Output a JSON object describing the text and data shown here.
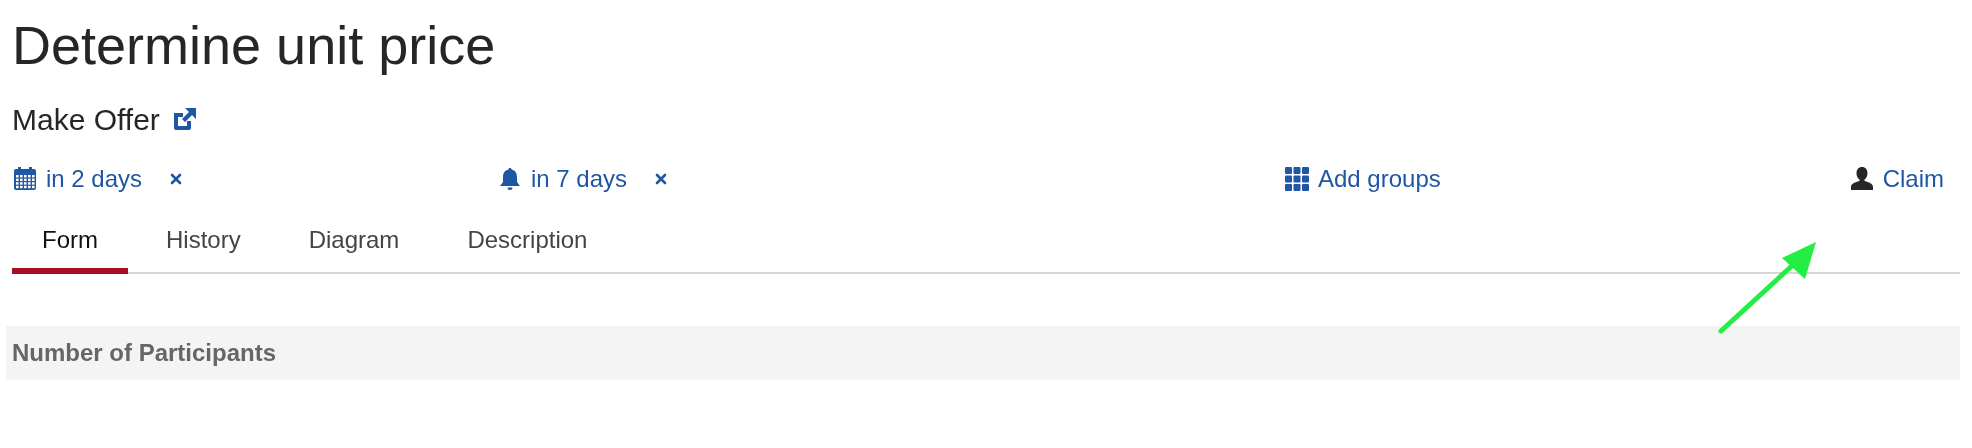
{
  "title": "Determine unit price",
  "process": {
    "label": "Make Offer"
  },
  "dates": [
    {
      "kind": "due",
      "text": "in 2 days"
    },
    {
      "kind": "reminder",
      "text": "in 7 days"
    }
  ],
  "groups": {
    "label": "Add groups"
  },
  "claim": {
    "label": "Claim"
  },
  "tabs": [
    {
      "label": "Form",
      "selected": true
    },
    {
      "label": "History",
      "selected": false
    },
    {
      "label": "Diagram",
      "selected": false
    },
    {
      "label": "Description",
      "selected": false
    }
  ],
  "section": {
    "heading": "Number of Participants"
  }
}
